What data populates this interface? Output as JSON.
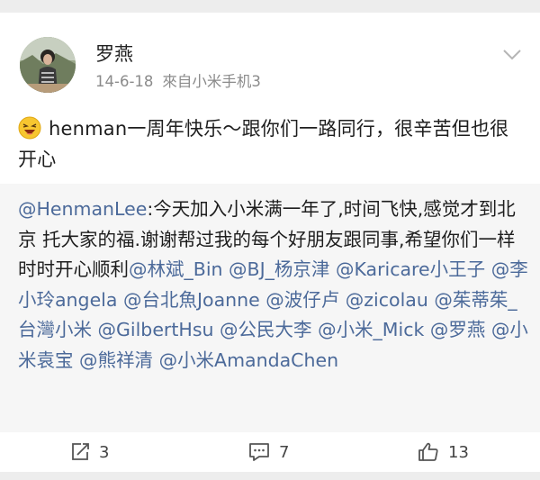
{
  "post": {
    "username": "罗燕",
    "date": "14-6-18",
    "source": "來自小米手机3",
    "text": "henman一周年快乐～跟你们一路同行，很辛苦但也很开心"
  },
  "repost": {
    "segments": [
      {
        "text": "@HenmanLee",
        "mention": true
      },
      {
        "text": ":今天加入小米满一年了,时间飞快,感觉才到北京 托大家的福.谢谢帮过我的每个好朋友跟同事,希望你们一样时时开心顺利",
        "mention": false
      },
      {
        "text": "@林斌_Bin",
        "mention": true
      },
      {
        "text": " ",
        "mention": false
      },
      {
        "text": "@BJ_杨京津",
        "mention": true
      },
      {
        "text": " ",
        "mention": false
      },
      {
        "text": "@Karicare小王子",
        "mention": true
      },
      {
        "text": " ",
        "mention": false
      },
      {
        "text": "@李小玲angela",
        "mention": true
      },
      {
        "text": " ",
        "mention": false
      },
      {
        "text": "@台北魚Joanne",
        "mention": true
      },
      {
        "text": " ",
        "mention": false
      },
      {
        "text": "@波仔卢",
        "mention": true
      },
      {
        "text": " ",
        "mention": false
      },
      {
        "text": "@zicolau",
        "mention": true
      },
      {
        "text": " ",
        "mention": false
      },
      {
        "text": "@茱蒂茱_台灣小米",
        "mention": true
      },
      {
        "text": " ",
        "mention": false
      },
      {
        "text": "@GilbertHsu",
        "mention": true
      },
      {
        "text": " ",
        "mention": false
      },
      {
        "text": "@公民大李",
        "mention": true
      },
      {
        "text": " ",
        "mention": false
      },
      {
        "text": "@小米_Mick",
        "mention": true
      },
      {
        "text": " ",
        "mention": false
      },
      {
        "text": "@罗燕",
        "mention": true
      },
      {
        "text": " ",
        "mention": false
      },
      {
        "text": "@小米袁宝",
        "mention": true
      },
      {
        "text": " ",
        "mention": false
      },
      {
        "text": "@熊祥清",
        "mention": true
      },
      {
        "text": " ",
        "mention": false
      },
      {
        "text": "@小米AmandaChen",
        "mention": true
      }
    ]
  },
  "actions": {
    "repost_count": "3",
    "comment_count": "7",
    "like_count": "13"
  },
  "icons": {
    "emoji": "laughing-face-icon",
    "menu": "chevron-down-icon",
    "repost": "repost-icon",
    "comment": "comment-icon",
    "like": "thumbs-up-icon"
  },
  "colors": {
    "mention": "#4c6a9a",
    "meta": "#8b8b8b",
    "repost_bg": "#f6f6f6",
    "page_bg": "#ededed"
  }
}
